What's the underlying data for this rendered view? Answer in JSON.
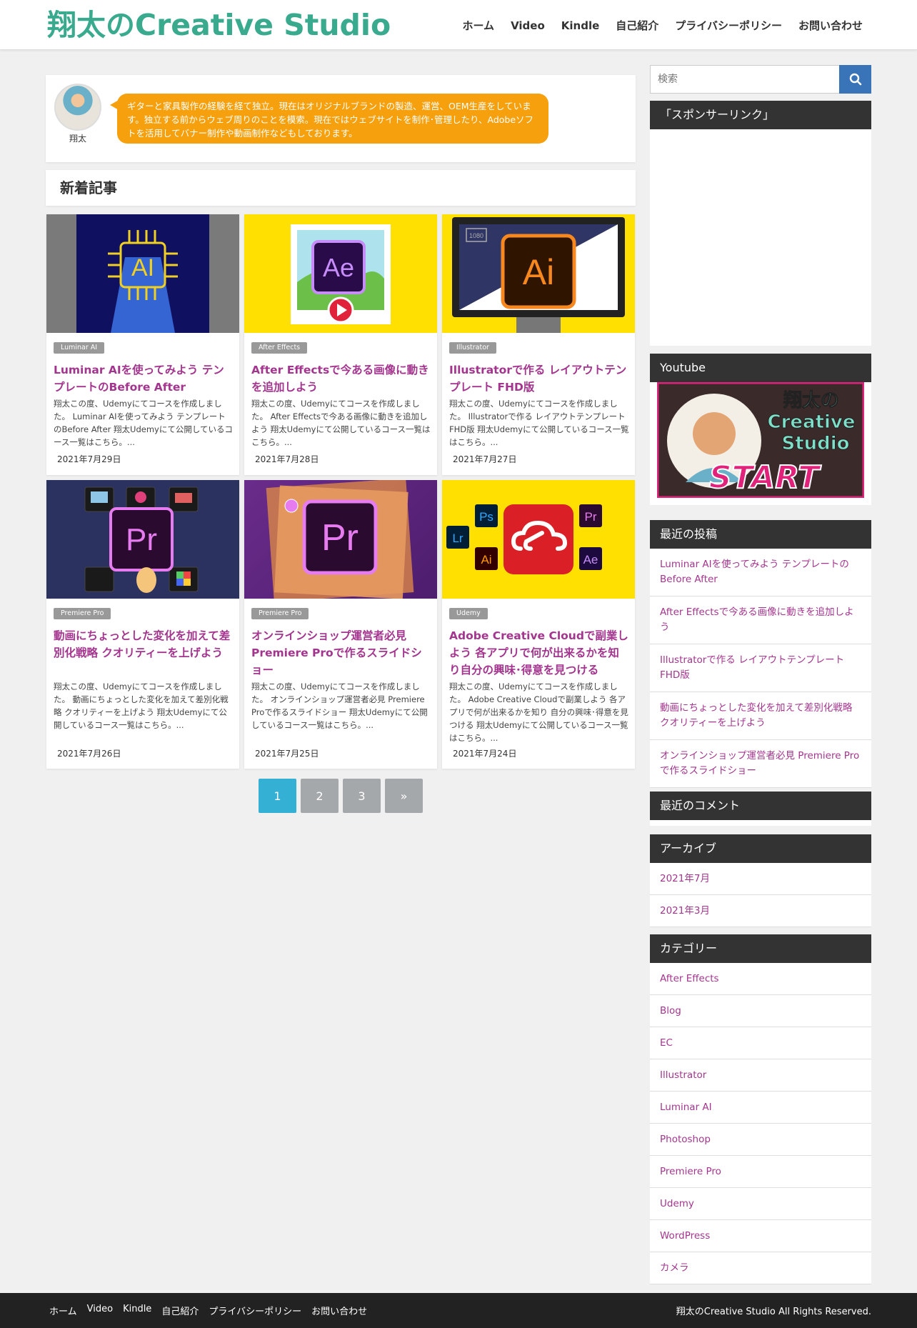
{
  "header": {
    "logo": "翔太のCreative Studio",
    "nav": [
      "ホーム",
      "Video",
      "Kindle",
      "自己紹介",
      "プライバシーポリシー",
      "お問い合わせ"
    ]
  },
  "profile": {
    "name": "翔太",
    "bio": "ギターと家具製作の経験を経て独立。現在はオリジナルブランドの製造、運営、OEM生産をしています。独立する前からウェブ周りのことを模索。現在ではウェブサイトを制作･管理したり、Adobeソフトを活用してバナー制作や動画制作などもしております。"
  },
  "section_title": "新着記事",
  "articles": [
    {
      "category": "Luminar AI",
      "title": "Luminar AIを使ってみよう テンプレートのBefore After",
      "excerpt": "翔太この度、Udemyにてコースを作成しました。 Luminar AIを使ってみよう テンプレートのBefore After 翔太Udemyにて公開しているコース一覧はこちら。...",
      "date": "2021年7月29日",
      "thumb_text": "AI"
    },
    {
      "category": "After Effects",
      "title": "After Effectsで今ある画像に動きを追加しよう",
      "excerpt": "翔太この度、Udemyにてコースを作成しました。 After Effectsで今ある画像に動きを追加しよう 翔太Udemyにて公開しているコース一覧はこちら。...",
      "date": "2021年7月28日",
      "thumb_text": "Ae"
    },
    {
      "category": "Illustrator",
      "title": "Illustratorで作る レイアウトテンプレート FHD版",
      "excerpt": "翔太この度、Udemyにてコースを作成しました。 Illustratorで作る レイアウトテンプレート FHD版 翔太Udemyにて公開しているコース一覧はこちら。...",
      "date": "2021年7月27日",
      "thumb_text": "Ai",
      "thumb_badge": "1080"
    },
    {
      "category": "Premiere Pro",
      "title": "動画にちょっとした変化を加えて差別化戦略 クオリティーを上げよう",
      "excerpt": "翔太この度、Udemyにてコースを作成しました。 動画にちょっとした変化を加えて差別化戦略 クオリティーを上げよう 翔太Udemyにて公開しているコース一覧はこちら。...",
      "date": "2021年7月26日",
      "thumb_text": "Pr"
    },
    {
      "category": "Premiere Pro",
      "title": "オンラインショップ運営者必見 Premiere Proで作るスライドショー",
      "excerpt": "翔太この度、Udemyにてコースを作成しました。 オンラインショップ運営者必見 Premiere Proで作るスライドショー 翔太Udemyにて公開しているコース一覧はこちら。...",
      "date": "2021年7月25日",
      "thumb_text": "Pr"
    },
    {
      "category": "Udemy",
      "title": "Adobe Creative Cloudで副業しよう 各アプリで何が出来るかを知り自分の興味･得意を見つける",
      "excerpt": "翔太この度、Udemyにてコースを作成しました。 Adobe Creative Cloudで副業しよう 各アプリで何が出来るかを知り 自分の興味･得意を見つける 翔太Udemyにて公開しているコース一覧はこちら。...",
      "date": "2021年7月24日",
      "thumb_labels": [
        "Ps",
        "Lr",
        "Ai",
        "Pr",
        "Ae"
      ]
    }
  ],
  "pagination": [
    "1",
    "2",
    "3",
    "»"
  ],
  "sidebar": {
    "search_placeholder": "検索",
    "sponsor_title": "「スポンサーリンク」",
    "youtube_title": "Youtube",
    "youtube_banner": {
      "text1": "翔太の",
      "text2": "Creative",
      "text3": "Studio",
      "text4": "START"
    },
    "recent_posts_title": "最近の投稿",
    "recent_posts": [
      "Luminar AIを使ってみよう テンプレートのBefore After",
      "After Effectsで今ある画像に動きを追加しよう",
      "Illustratorで作る レイアウトテンプレート FHD版",
      "動画にちょっとした変化を加えて差別化戦略 クオリティーを上げよう",
      "オンラインショップ運営者必見 Premiere Proで作るスライドショー"
    ],
    "recent_comments_title": "最近のコメント",
    "archives_title": "アーカイブ",
    "archives": [
      "2021年7月",
      "2021年3月"
    ],
    "categories_title": "カテゴリー",
    "categories": [
      "After Effects",
      "Blog",
      "EC",
      "Illustrator",
      "Luminar AI",
      "Photoshop",
      "Premiere Pro",
      "Udemy",
      "WordPress",
      "カメラ"
    ]
  },
  "footer": {
    "nav": [
      "ホーム",
      "Video",
      "Kindle",
      "自己紹介",
      "プライバシーポリシー",
      "お問い合わせ"
    ],
    "copyright": "翔太のCreative Studio All Rights Reserved."
  },
  "colors": {
    "accent_link": "#a4358e",
    "logo": "#3aaa8e",
    "bubble": "#f5a00c",
    "search_button": "#3a74b8",
    "page_active": "#34b0d5"
  }
}
